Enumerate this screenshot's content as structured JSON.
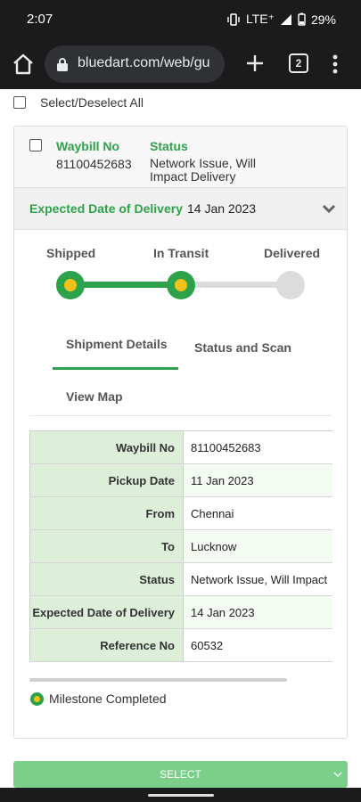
{
  "status_bar": {
    "time": "2:07",
    "network": "LTE⁺",
    "battery": "29%"
  },
  "browser": {
    "url": "bluedart.com/web/gu",
    "tab_count": "2"
  },
  "select_all_label": "Select/Deselect All",
  "card": {
    "waybill_label": "Waybill No",
    "waybill_value": "81100452683",
    "status_label": "Status",
    "status_value": "Network Issue, Will Impact Delivery",
    "edd_label": "Expected Date of Delivery",
    "edd_value": "14 Jan 2023"
  },
  "tracker": {
    "stages": [
      {
        "label": "Shipped",
        "completed": true
      },
      {
        "label": "In Transit",
        "completed": true
      },
      {
        "label": "Delivered",
        "completed": false
      }
    ]
  },
  "tabs": [
    {
      "label": "Shipment Details",
      "active": true
    },
    {
      "label": "Status and Scan",
      "active": false
    },
    {
      "label": "View Map",
      "active": false
    }
  ],
  "details": [
    {
      "key": "Waybill No",
      "value": "81100452683"
    },
    {
      "key": "Pickup Date",
      "value": "11 Jan 2023"
    },
    {
      "key": "From",
      "value": "Chennai"
    },
    {
      "key": "To",
      "value": "Lucknow"
    },
    {
      "key": "Status",
      "value": "Network Issue, Will Impact"
    },
    {
      "key": "Expected Date of Delivery",
      "value": "14 Jan 2023"
    },
    {
      "key": "Reference No",
      "value": "60532"
    }
  ],
  "legend_label": "Milestone Completed",
  "select_button_label": "SELECT",
  "colors": {
    "accent": "#2ea24a",
    "milestone": "#f2c21b",
    "button": "#7ccf8b",
    "table_key_bg": "#ddefd8"
  }
}
